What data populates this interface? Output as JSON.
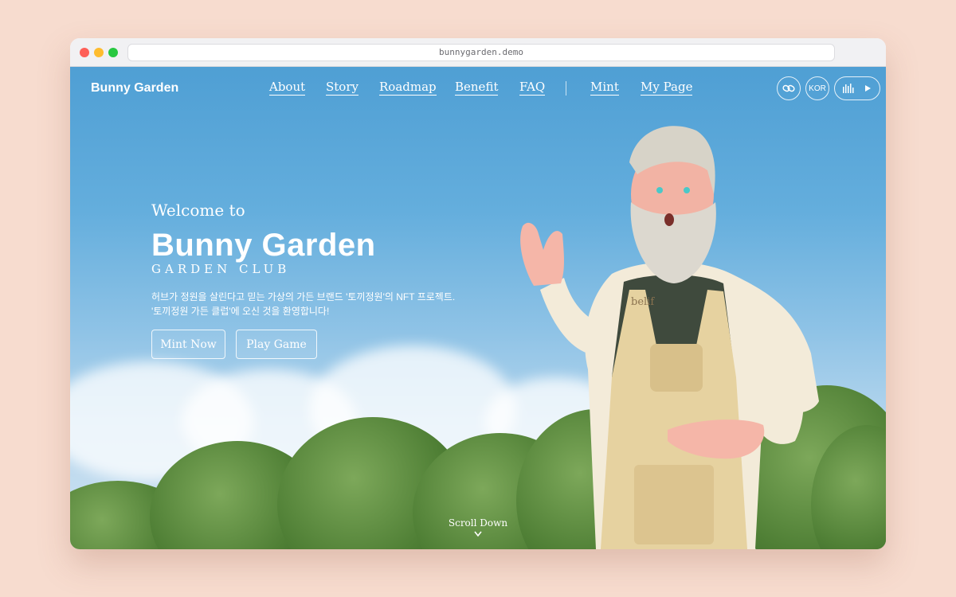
{
  "browser": {
    "url": "bunnygarden.demo"
  },
  "header": {
    "brand": "Bunny Garden",
    "nav": [
      "About",
      "Story",
      "Roadmap",
      "Benefit",
      "FAQ",
      "Mint",
      "My Page"
    ],
    "language": "KOR"
  },
  "hero": {
    "welcome": "Welcome to",
    "title": "Bunny Garden",
    "subtitle": "GARDEN CLUB",
    "description_line1": "허브가 정원을 살린다고 믿는 가상의 가든 브랜드 '토끼정원'의 NFT 프로젝트.",
    "description_line2": "'토끼정원 가든 클럽'에 오신 것을 환영합니다!",
    "buttons": {
      "mint": "Mint Now",
      "play": "Play Game"
    },
    "scroll": "Scroll Down",
    "apron_logo": "belif"
  },
  "colors": {
    "page_bg": "#f7dccf",
    "sky_top": "#4f9fd4",
    "sky_bottom": "#cfe2f1",
    "foliage": "#4f7f35",
    "apron": "#e6d2a0"
  },
  "icons": [
    "link-icon",
    "equalizer-icon",
    "play-icon",
    "chevron-down-icon"
  ]
}
